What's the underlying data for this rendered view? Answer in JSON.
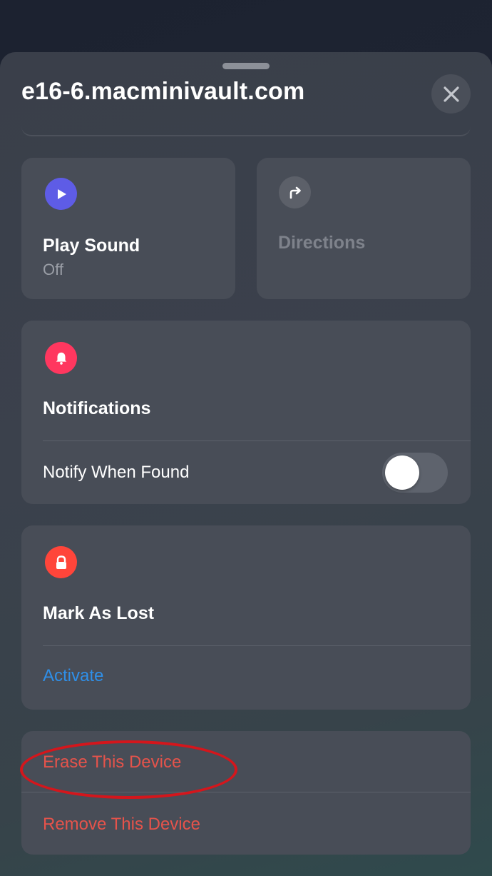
{
  "header": {
    "title": "e16-6.macminivault.com",
    "close_icon": "close-icon"
  },
  "play_sound": {
    "label": "Play Sound",
    "status": "Off",
    "icon": "play-icon",
    "icon_color": "#5e5ce6"
  },
  "directions": {
    "label": "Directions",
    "icon": "turn-right-arrow-icon"
  },
  "notifications": {
    "label": "Notifications",
    "icon": "bell-icon",
    "icon_color": "#ff375f",
    "notify_when_found_label": "Notify When Found",
    "notify_when_found_on": false
  },
  "mark_as_lost": {
    "label": "Mark As Lost",
    "icon": "lock-icon",
    "icon_color": "#ff453a",
    "action_label": "Activate",
    "action_color": "#0a84ff"
  },
  "device_actions": {
    "erase_label": "Erase This Device",
    "remove_label": "Remove This Device",
    "destructive_color": "#e5534b"
  },
  "annotation": {
    "highlight_color": "#d4161c"
  }
}
